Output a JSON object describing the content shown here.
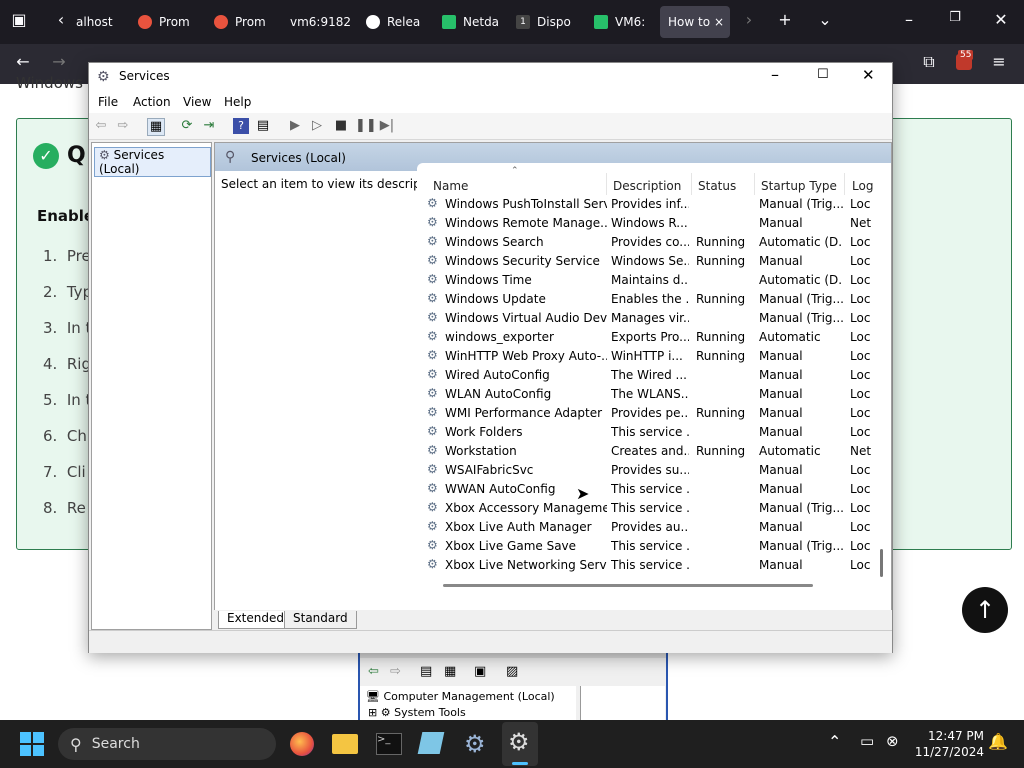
{
  "browser": {
    "tabs": [
      {
        "label": "alhost",
        "color": ""
      },
      {
        "label": "Prom",
        "color": "#e8533e"
      },
      {
        "label": "Prom",
        "color": "#e8533e"
      },
      {
        "label": "vm6:9182",
        "color": ""
      },
      {
        "label": "Relea",
        "color": "#ffffff"
      },
      {
        "label": "Netda",
        "color": "#27c06a"
      },
      {
        "label": "Dispo",
        "color": "#333333"
      },
      {
        "label": "VM6:",
        "color": "#27c06a"
      },
      {
        "label": "How to",
        "color": ""
      }
    ],
    "dispo_number": "1",
    "notification_count": "55"
  },
  "page": {
    "partial_heading_behind": "Windows",
    "card_title_initial": "Q",
    "card_subheading": "Enable",
    "steps": [
      {
        "num": "1.",
        "text": "Pre"
      },
      {
        "num": "2.",
        "text": "Typ"
      },
      {
        "num": "3.",
        "text": "In t"
      },
      {
        "num": "4.",
        "text": "Rig"
      },
      {
        "num": "5.",
        "text": "In t"
      },
      {
        "num": "6.",
        "text": "Ch"
      },
      {
        "num": "7.",
        "text": "Cli"
      },
      {
        "num": "8.",
        "text": "Re"
      }
    ]
  },
  "services_window": {
    "title": "Services",
    "menu": [
      "File",
      "Action",
      "View",
      "Help"
    ],
    "tree_item": "Services (Local)",
    "pane_title": "Services (Local)",
    "description_prompt": "Select an item to view its description.",
    "columns": [
      "Name",
      "Description",
      "Status",
      "Startup Type",
      "Log"
    ],
    "rows": [
      {
        "name": "Windows PushToInstall Serv...",
        "description": "Provides inf...",
        "status": "",
        "startup": "Manual (Trig...",
        "log": "Loc"
      },
      {
        "name": "Windows Remote Manage...",
        "description": "Windows R...",
        "status": "",
        "startup": "Manual",
        "log": "Net"
      },
      {
        "name": "Windows Search",
        "description": "Provides co...",
        "status": "Running",
        "startup": "Automatic (D...",
        "log": "Loc"
      },
      {
        "name": "Windows Security Service",
        "description": "Windows Se...",
        "status": "Running",
        "startup": "Manual",
        "log": "Loc"
      },
      {
        "name": "Windows Time",
        "description": "Maintains d...",
        "status": "",
        "startup": "Automatic (D...",
        "log": "Loc"
      },
      {
        "name": "Windows Update",
        "description": "Enables the ...",
        "status": "Running",
        "startup": "Manual (Trig...",
        "log": "Loc"
      },
      {
        "name": "Windows Virtual Audio Devi...",
        "description": "Manages vir...",
        "status": "",
        "startup": "Manual (Trig...",
        "log": "Loc"
      },
      {
        "name": "windows_exporter",
        "description": "Exports Pro...",
        "status": "Running",
        "startup": "Automatic",
        "log": "Loc"
      },
      {
        "name": "WinHTTP Web Proxy Auto-...",
        "description": "WinHTTP i...",
        "status": "Running",
        "startup": "Manual",
        "log": "Loc"
      },
      {
        "name": "Wired AutoConfig",
        "description": "The Wired ...",
        "status": "",
        "startup": "Manual",
        "log": "Loc"
      },
      {
        "name": "WLAN AutoConfig",
        "description": "The WLANS...",
        "status": "",
        "startup": "Manual",
        "log": "Loc"
      },
      {
        "name": "WMI Performance Adapter",
        "description": "Provides pe...",
        "status": "Running",
        "startup": "Manual",
        "log": "Loc"
      },
      {
        "name": "Work Folders",
        "description": "This service ...",
        "status": "",
        "startup": "Manual",
        "log": "Loc"
      },
      {
        "name": "Workstation",
        "description": "Creates and...",
        "status": "Running",
        "startup": "Automatic",
        "log": "Net"
      },
      {
        "name": "WSAIFabricSvc",
        "description": "Provides su...",
        "status": "",
        "startup": "Manual",
        "log": "Loc"
      },
      {
        "name": "WWAN AutoConfig",
        "description": "This service ...",
        "status": "",
        "startup": "Manual",
        "log": "Loc"
      },
      {
        "name": "Xbox Accessory Manageme...",
        "description": "This service ...",
        "status": "",
        "startup": "Manual (Trig...",
        "log": "Loc"
      },
      {
        "name": "Xbox Live Auth Manager",
        "description": "Provides au...",
        "status": "",
        "startup": "Manual",
        "log": "Loc"
      },
      {
        "name": "Xbox Live Game Save",
        "description": "This service ...",
        "status": "",
        "startup": "Manual (Trig...",
        "log": "Loc"
      },
      {
        "name": "Xbox Live Networking Service",
        "description": "This service ...",
        "status": "",
        "startup": "Manual",
        "log": "Loc"
      }
    ],
    "bottom_tabs": [
      "Extended",
      "Standard"
    ]
  },
  "computer_management": {
    "tree_root": "Computer Management (Local)",
    "tree_child": "System Tools"
  },
  "taskbar": {
    "search_label": "Search",
    "time": "12:47 PM",
    "date": "11/27/2024"
  }
}
